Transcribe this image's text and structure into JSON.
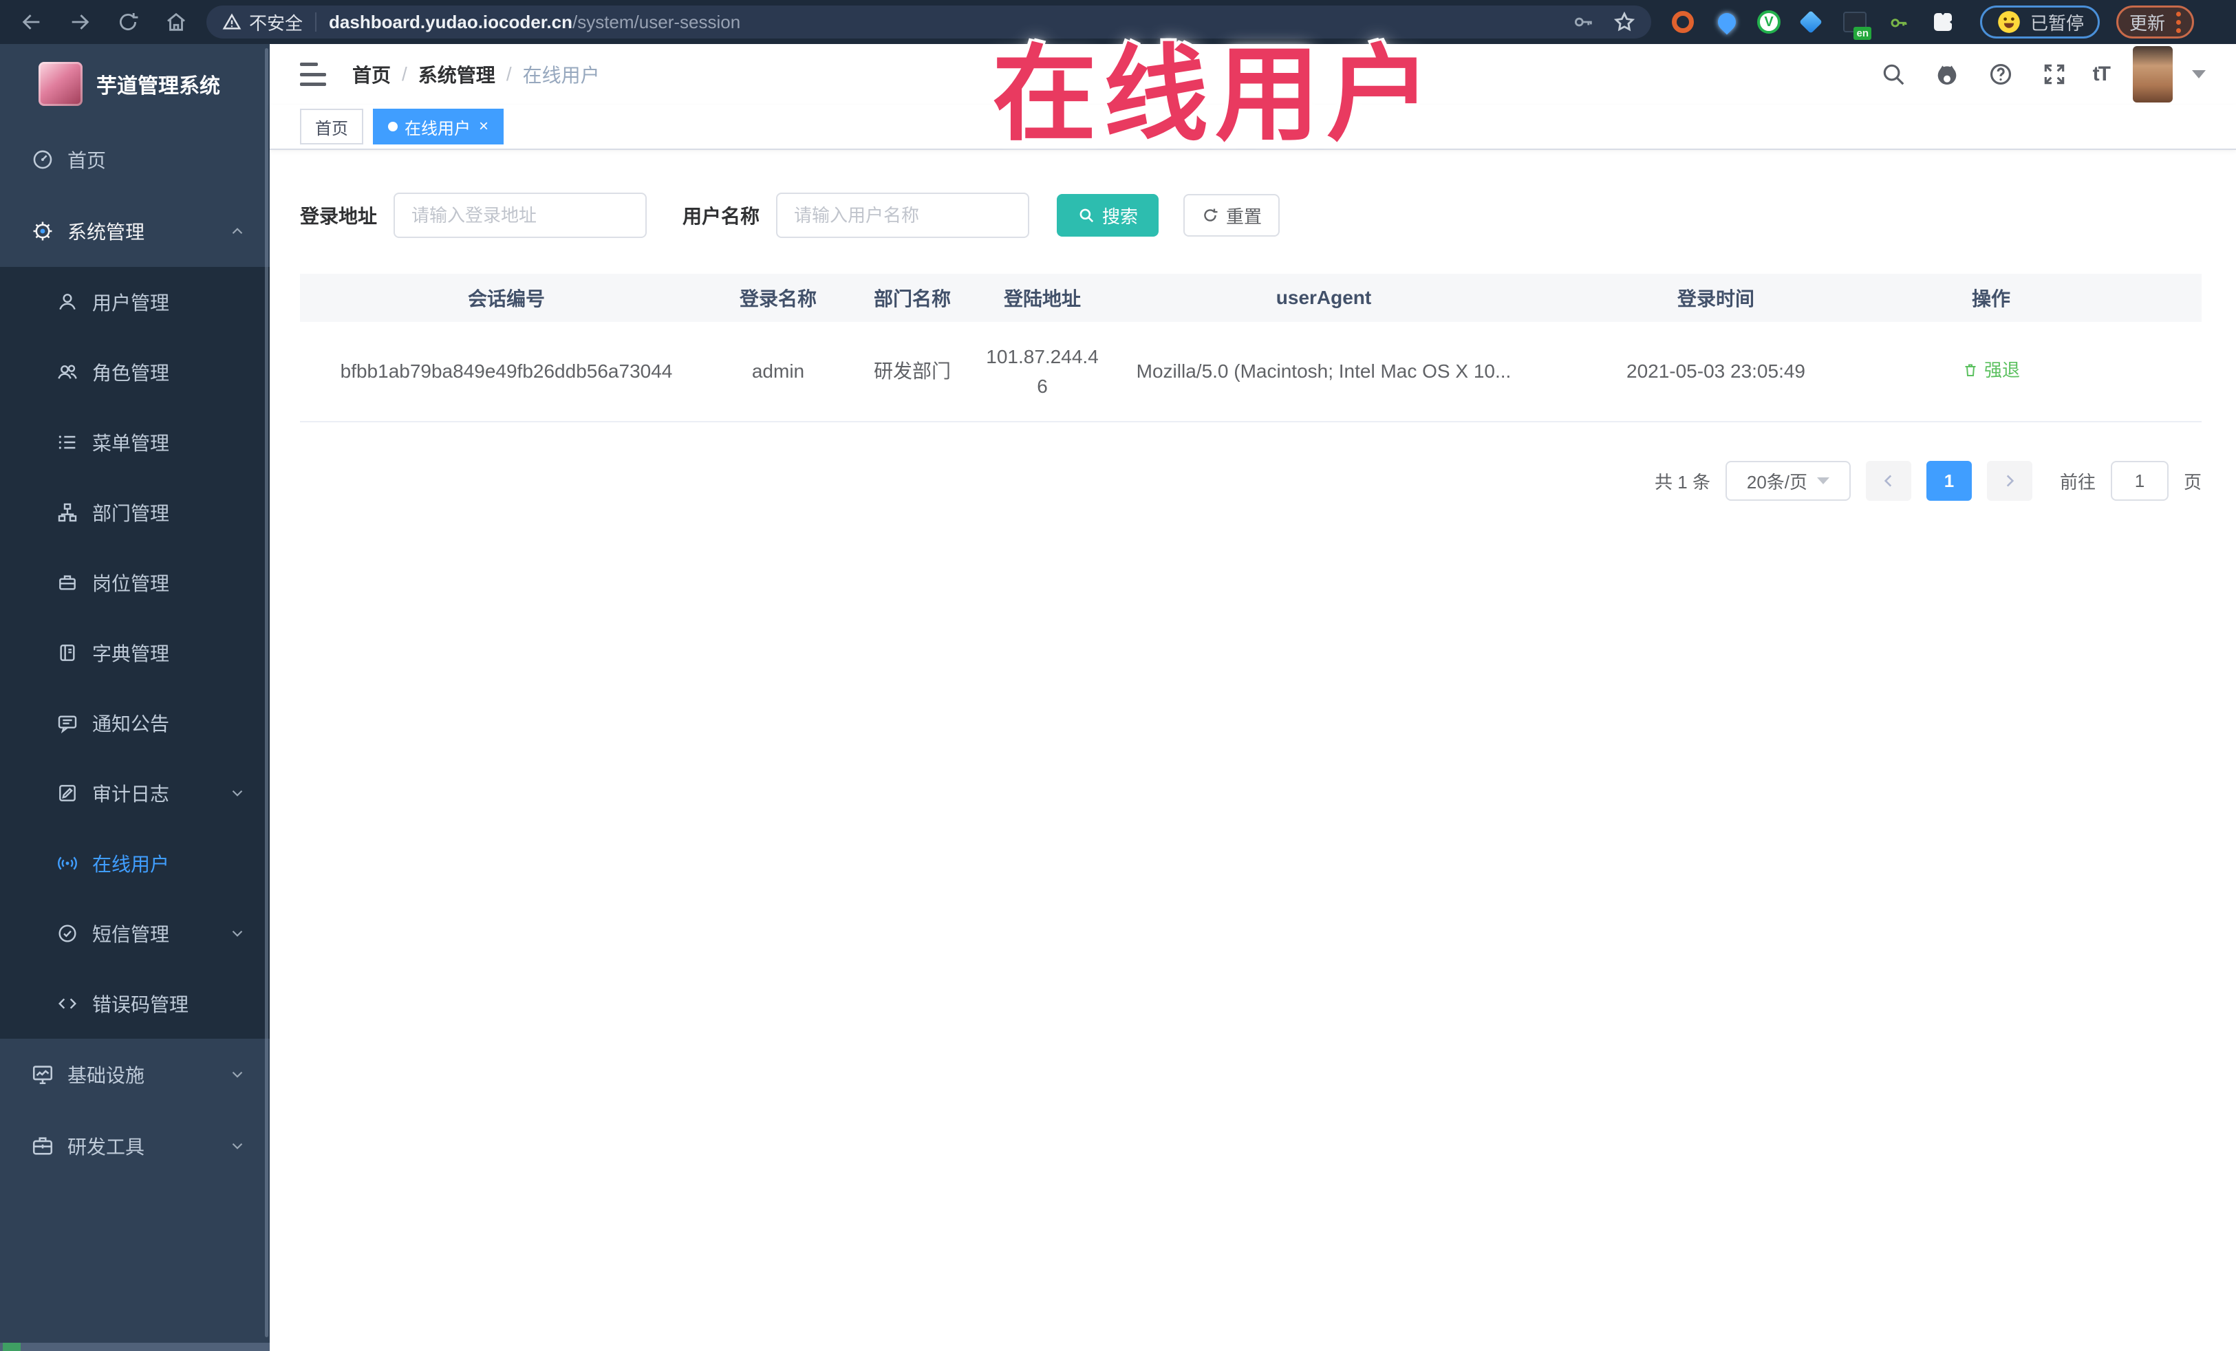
{
  "colors": {
    "accent_blue": "#409eff",
    "search_teal": "#2dbdaf",
    "action_green": "#5bc05f",
    "annotation_red": "#e93a60",
    "sidebar_bg": "#304156",
    "submenu_bg": "#1f2d3d",
    "chrome_bg": "#1d2a3a"
  },
  "browser": {
    "security_label": "不安全",
    "url_host": "dashboard.yudao.iocoder.cn",
    "url_path": "/system/user-session",
    "translate_badge": "en",
    "circle_ext_letter": "V",
    "paused_badge": "已暂停",
    "update_button": "更新"
  },
  "annotation": {
    "text": "在线用户"
  },
  "sidebar": {
    "title": "芋道管理系统",
    "items": [
      {
        "label": "首页"
      },
      {
        "label": "系统管理"
      },
      {
        "label": "用户管理"
      },
      {
        "label": "角色管理"
      },
      {
        "label": "菜单管理"
      },
      {
        "label": "部门管理"
      },
      {
        "label": "岗位管理"
      },
      {
        "label": "字典管理"
      },
      {
        "label": "通知公告"
      },
      {
        "label": "审计日志"
      },
      {
        "label": "在线用户"
      },
      {
        "label": "短信管理"
      },
      {
        "label": "错误码管理"
      },
      {
        "label": "基础设施"
      },
      {
        "label": "研发工具"
      }
    ]
  },
  "header": {
    "breadcrumb": [
      "首页",
      "系统管理",
      "在线用户"
    ],
    "breadcrumb_sep": "/",
    "font_size_icon_label": "tT"
  },
  "tags": {
    "home": "首页",
    "active": "在线用户",
    "close_glyph": "×"
  },
  "filters": {
    "login_address_label": "登录地址",
    "login_address_placeholder": "请输入登录地址",
    "username_label": "用户名称",
    "username_placeholder": "请输入用户名称",
    "search_label": "搜索",
    "reset_label": "重置"
  },
  "table": {
    "columns": [
      "会话编号",
      "登录名称",
      "部门名称",
      "登陆地址",
      "userAgent",
      "登录时间",
      "操作"
    ],
    "rows": [
      {
        "session_id": "bfbb1ab79ba849e49fb26ddb56a73044",
        "username": "admin",
        "dept": "研发部门",
        "ip": "101.87.244.46",
        "user_agent": "Mozilla/5.0 (Macintosh; Intel Mac OS X 10...",
        "login_time": "2021-05-03 23:05:49",
        "action": "强退"
      }
    ]
  },
  "pagination": {
    "total": "共 1 条",
    "page_size": "20条/页",
    "current_page": "1",
    "goto_label": "前往",
    "goto_value": "1",
    "page_suffix": "页"
  }
}
